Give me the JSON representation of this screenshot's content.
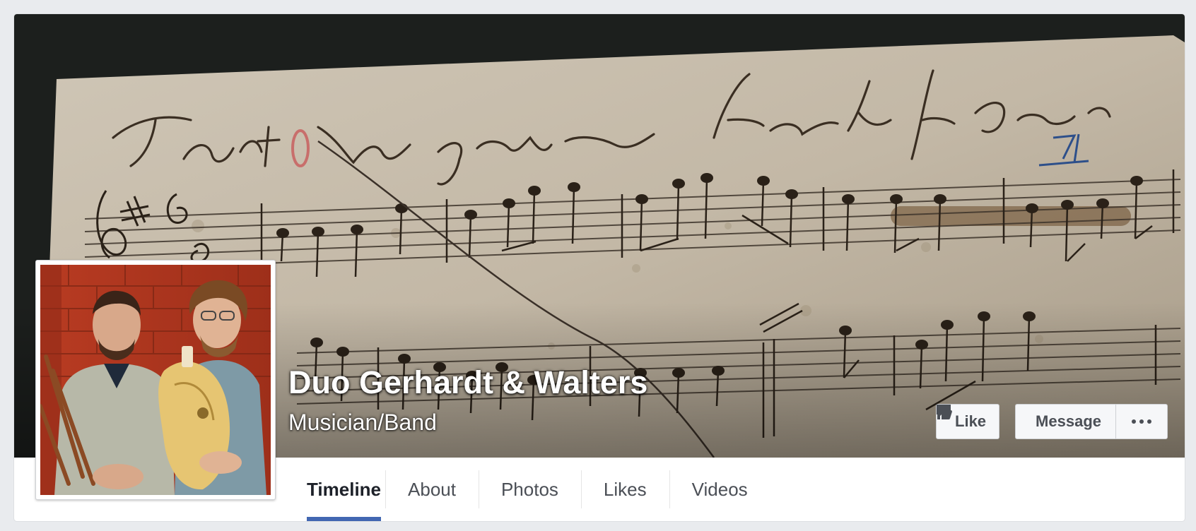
{
  "page": {
    "name": "Duo Gerhardt & Walters",
    "category": "Musician/Band"
  },
  "cover_photo": {
    "subject": "handwritten music manuscript",
    "manuscript_text": "Tant. Kein grössern freund auf Erden ist.",
    "page_number": "71."
  },
  "profile_photo": {
    "subject": "two musicians with instruments in front of brick wall"
  },
  "actions": {
    "like_label": "Like",
    "like_icon": "thumbs-up-icon",
    "message_label": "Message",
    "message_icon": "speech-bubble-icon",
    "more_icon": "more-dots-icon"
  },
  "tabs": [
    {
      "label": "Timeline",
      "active": true
    },
    {
      "label": "About",
      "active": false
    },
    {
      "label": "Photos",
      "active": false
    },
    {
      "label": "Likes",
      "active": false
    },
    {
      "label": "Videos",
      "active": false
    }
  ],
  "colors": {
    "accent": "#4267b2",
    "background": "#e9ebee",
    "button_text": "#4b4f56"
  }
}
